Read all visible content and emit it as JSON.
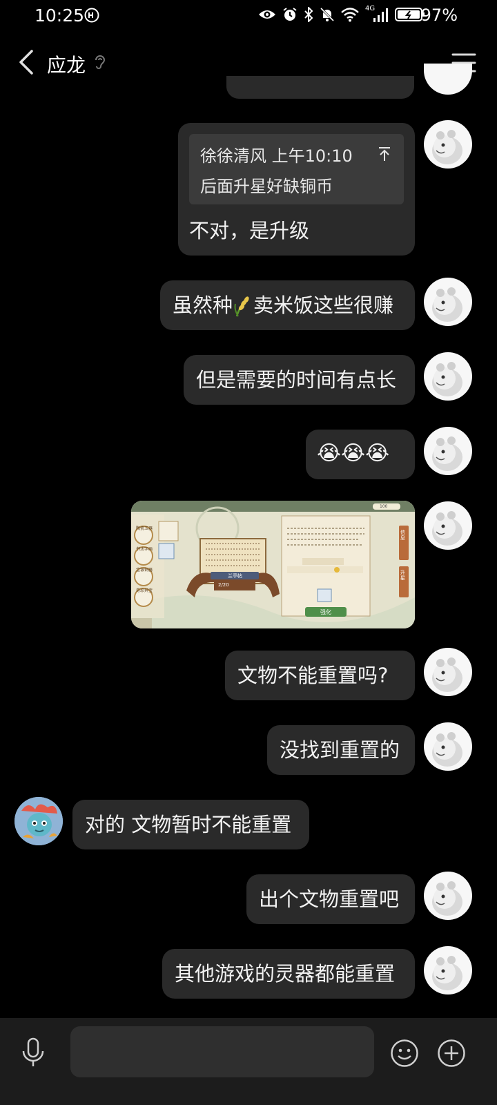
{
  "status_bar": {
    "time": "10:25",
    "network": "4G",
    "battery": "97%"
  },
  "header": {
    "title": "应龙"
  },
  "messages": [
    {
      "quote_author": "徐徐清风 上午10:10",
      "quote_text": "后面升星好缺铜币",
      "text": "不对，是升级"
    },
    {
      "text_before": "虽然种",
      "text_after": "卖米饭这些很赚"
    },
    {
      "text": "但是需要的时间有点长"
    },
    {
      "text": "😭😭😭"
    },
    {
      "text": "文物不能重置吗?"
    },
    {
      "text": "没找到重置的"
    },
    {
      "text": "对的 文物暂时不能重置"
    },
    {
      "text": "出个文物重置吧"
    },
    {
      "text": "其他游戏的灵器都能重置"
    }
  ],
  "screenshot": {
    "side_tabs": [
      "陶瓷玉器",
      "书法字画",
      "金银铜器",
      "奇珍异宝"
    ],
    "scroll_label": "兰亭帖",
    "scroll_progress": "2/20",
    "right_tabs": [
      "信息",
      "升星"
    ],
    "button": "强化",
    "coin_count": "100"
  },
  "colors": {
    "bubble": "#2a2a2a",
    "background": "#000000",
    "bottom_bar": "#1c1c1c"
  }
}
